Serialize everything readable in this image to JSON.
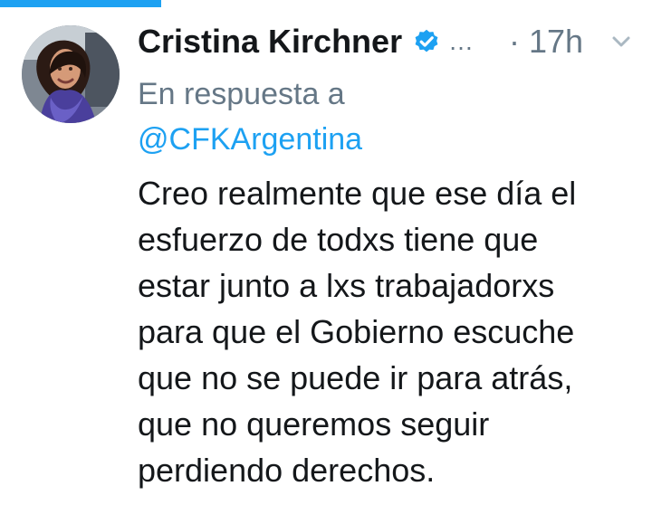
{
  "tweet": {
    "author_name": "Cristina Kirchner",
    "truncation": "…",
    "timestamp": "· 17h",
    "reply_label": "En respuesta a",
    "reply_handle": "@CFKArgentina",
    "body_lines": [
      "Creo realmente que ese día el",
      "esfuerzo de todxs tiene que",
      "estar junto a lxs trabajadorxs",
      "para que el Gobierno escuche",
      "que no se puede ir para atrás,",
      "que no queremos seguir",
      "perdiendo derechos."
    ],
    "icons": {
      "verified": "verified-badge-icon",
      "menu": "chevron-down-icon"
    }
  },
  "colors": {
    "accent": "#1da1f2",
    "text": "#14171a",
    "muted": "#657786",
    "background": "#ffffff"
  }
}
